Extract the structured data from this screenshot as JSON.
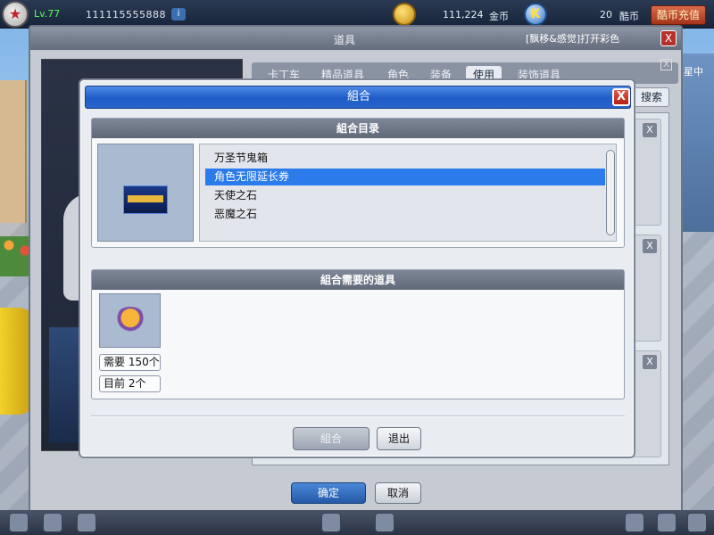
{
  "hud": {
    "level": "Lv.77",
    "user_id": "111115555888",
    "info_button": "i",
    "gold_value": "111,224",
    "gold_label": "金币",
    "kubi_value": "20",
    "kubi_label": "酷币",
    "recharge_label": "酷币充值"
  },
  "item_window": {
    "title": "道具",
    "chat_text": "[飘移&感觉]打开彩色",
    "close": "X",
    "tabs": [
      {
        "label": "卡丁车"
      },
      {
        "label": "精品道具"
      },
      {
        "label": "角色"
      },
      {
        "label": "装备"
      },
      {
        "label": "使用"
      },
      {
        "label": "装饰道具"
      }
    ],
    "active_tab": "使用",
    "search_label": "搜索",
    "right_x": "X",
    "right_text": "星中",
    "card_close": "X",
    "confirm_label": "确定",
    "cancel_label": "取消"
  },
  "combine": {
    "title": "組合",
    "close": "X",
    "catalog_header": "組合目录",
    "catalog_items": [
      {
        "label": "万圣节鬼箱"
      },
      {
        "label": "角色无限延长券"
      },
      {
        "label": "天使之石"
      },
      {
        "label": "恶魔之石"
      }
    ],
    "selected_index": 1,
    "required_header": "組合需要的道具",
    "need_label": "需要",
    "need_value": "150个",
    "current_label": "目前",
    "current_value": "2个",
    "combine_button": "組合",
    "exit_button": "退出"
  },
  "colors": {
    "title_blue": "#1f5cc7",
    "selected_blue": "#2b7bea",
    "close_red": "#b21f14"
  }
}
